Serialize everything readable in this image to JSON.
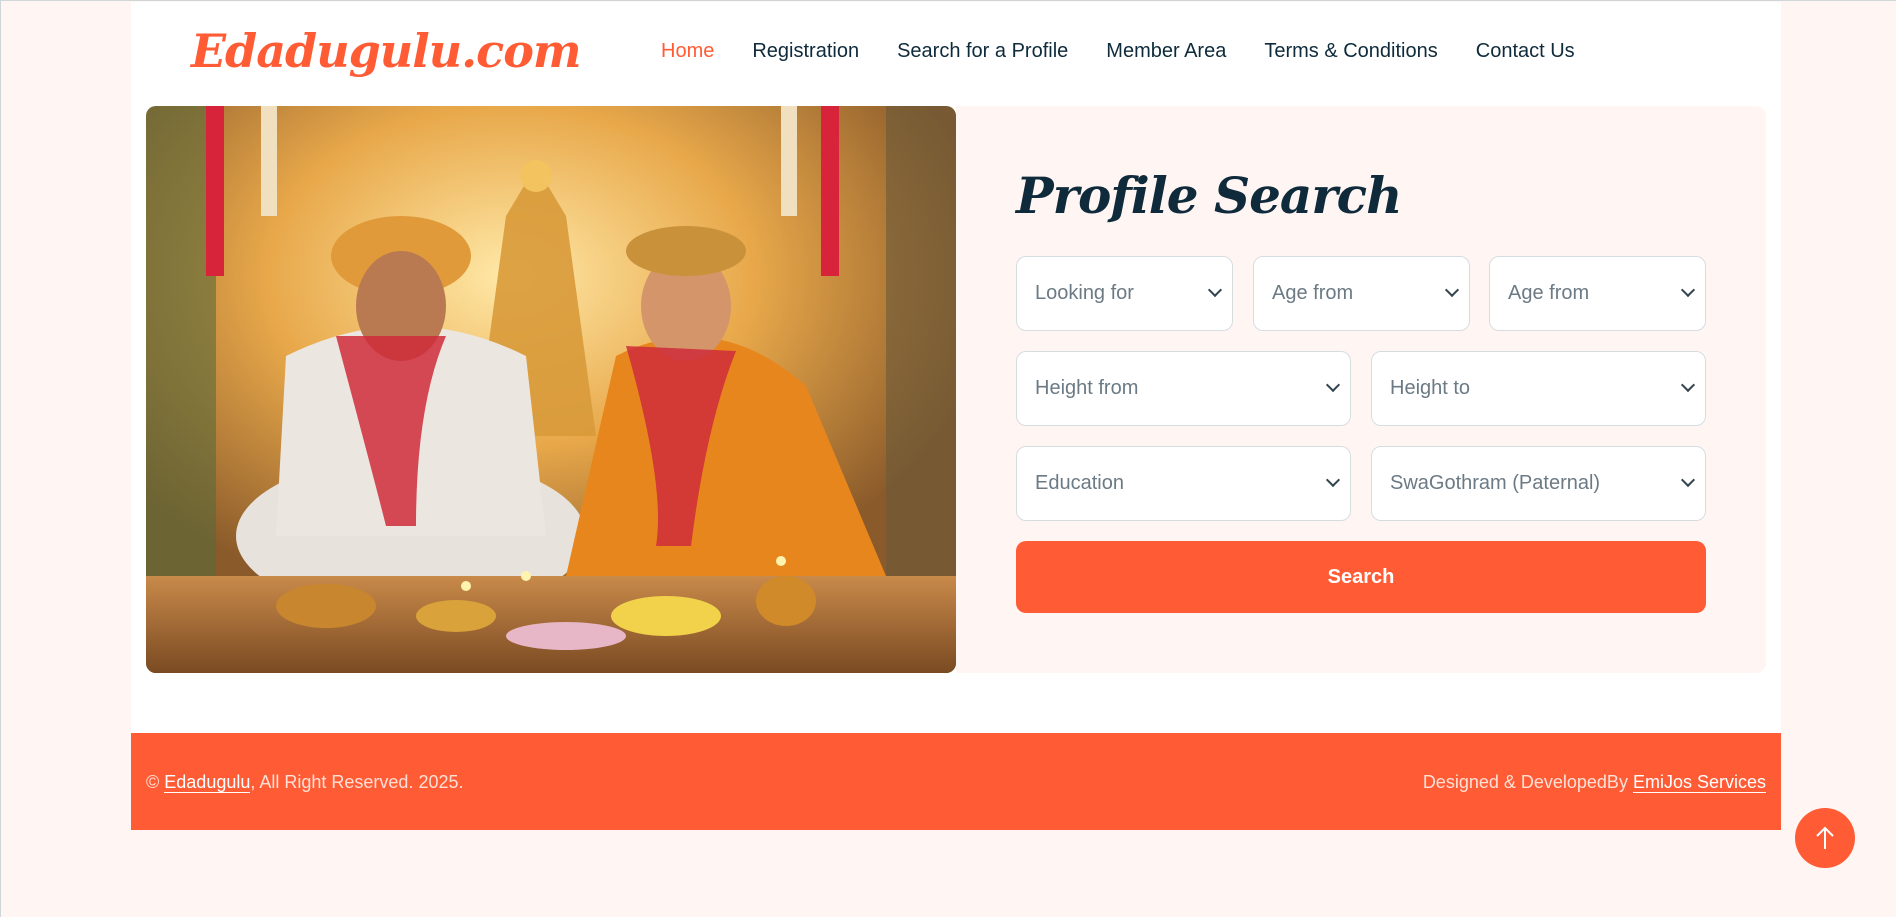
{
  "brand": {
    "logo": "Edadugulu.com",
    "accent": "#ff5c35",
    "dark": "#0e2a3b"
  },
  "nav": {
    "items": [
      {
        "label": "Home",
        "active": true
      },
      {
        "label": "Registration"
      },
      {
        "label": "Search for a Profile"
      },
      {
        "label": "Member Area"
      },
      {
        "label": "Terms & Conditions"
      },
      {
        "label": "Contact Us"
      }
    ]
  },
  "hero": {
    "image": "wedding-couple-illustration"
  },
  "search": {
    "title": "Profile Search",
    "fields": {
      "looking_for": "Looking for",
      "age_from": "Age from",
      "age_to": "Age from",
      "height_from": "Height from",
      "height_to": "Height to",
      "education": "Education",
      "gothram": "SwaGothram (Paternal)"
    },
    "button": "Search"
  },
  "footer": {
    "copyright_prefix": "©",
    "site_link": "Edadugulu",
    "rights": ", All Right Reserved. 2025.",
    "designed_prefix": "Designed & DevelopedBy",
    "designer_link": "EmiJos Services"
  },
  "back_to_top": "arrow-up-icon"
}
